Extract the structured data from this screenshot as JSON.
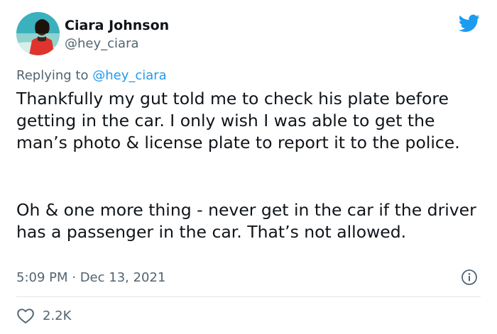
{
  "tweet": {
    "author": {
      "display_name": "Ciara Johnson",
      "handle": "@hey_ciara"
    },
    "reply": {
      "prefix": "Replying to",
      "mention": "@hey_ciara"
    },
    "body": {
      "paragraph_1": "Thankfully my gut told me to check his plate before getting in the car. I only wish I was able to get the man’s photo & license plate to report it to the police.",
      "paragraph_2": "Oh & one more thing - never get in the car if the driver has a passenger in the car. That’s not allowed."
    },
    "timestamp": "5:09 PM · Dec 13, 2021",
    "likes": "2.2K"
  },
  "icons": {
    "brand": "twitter-bird-icon",
    "info": "info-icon",
    "like": "heart-icon"
  },
  "colors": {
    "brand_blue": "#1d9bf0",
    "text_primary": "#0f1419",
    "text_secondary": "#536471",
    "divider": "#e1e8ed"
  }
}
